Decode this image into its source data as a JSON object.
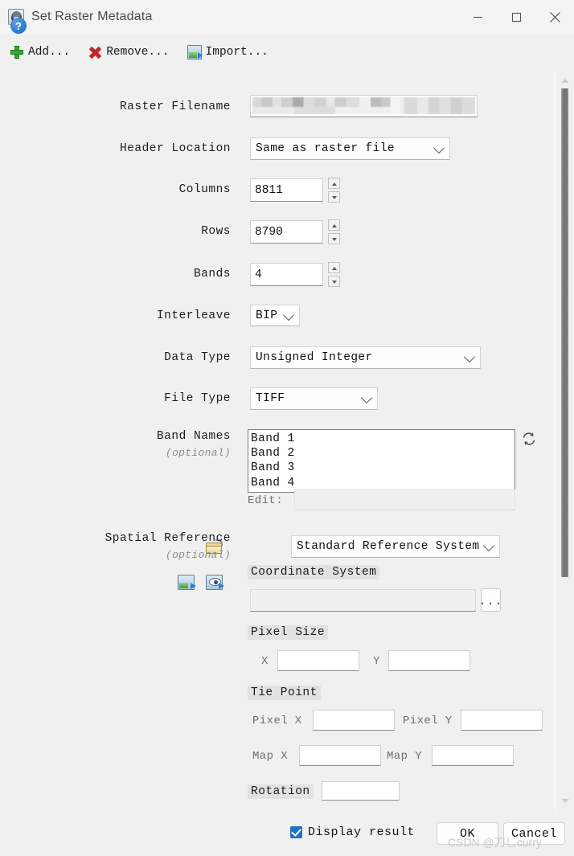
{
  "window": {
    "title": "Set Raster Metadata",
    "icon": "envi-app-icon",
    "controls": {
      "minimize": "minimize-icon",
      "maximize": "maximize-icon",
      "close": "close-icon"
    }
  },
  "toolbar": {
    "items": [
      {
        "label": "Add...",
        "icon": "plus-icon"
      },
      {
        "label": "Remove...",
        "icon": "red-x-icon"
      },
      {
        "label": "Import...",
        "icon": "import-image-icon"
      }
    ]
  },
  "form": {
    "raster_filename": {
      "label": "Raster Filename",
      "value": "",
      "redacted": true
    },
    "header_location": {
      "label": "Header Location",
      "value": "Same as raster file"
    },
    "columns": {
      "label": "Columns",
      "value": "8811"
    },
    "rows": {
      "label": "Rows",
      "value": "8790"
    },
    "bands": {
      "label": "Bands",
      "value": "4"
    },
    "interleave": {
      "label": "Interleave",
      "value": "BIP"
    },
    "data_type": {
      "label": "Data Type",
      "value": "Unsigned Integer"
    },
    "file_type": {
      "label": "File Type",
      "value": "TIFF"
    },
    "band_names": {
      "label": "Band Names",
      "sublabel": "(optional)",
      "items": [
        "Band 1",
        "Band 2",
        "Band 3",
        "Band 4"
      ],
      "edit_label": "Edit:",
      "edit_value": ""
    },
    "spatial_reference": {
      "label": "Spatial Reference",
      "sublabel": "(optional)",
      "mode": "Standard Reference System",
      "coordinate_system": {
        "header": "Coordinate System",
        "value": "",
        "browse_label": "..."
      },
      "pixel_size": {
        "header": "Pixel Size",
        "x_label": "X",
        "x_value": "",
        "y_label": "Y",
        "y_value": ""
      },
      "tie_point": {
        "header": "Tie Point",
        "pixel_x_label": "Pixel X",
        "pixel_x_value": "",
        "pixel_y_label": "Pixel Y",
        "pixel_y_value": "",
        "map_x_label": "Map X",
        "map_x_value": "",
        "map_y_label": "Map Y",
        "map_y_value": ""
      },
      "rotation": {
        "label": "Rotation",
        "value": ""
      }
    }
  },
  "footer": {
    "help_label": "?",
    "display_result": {
      "label": "Display result",
      "checked": true
    },
    "ok_label": "OK",
    "cancel_label": "Cancel"
  },
  "watermark": "CSDN @刀乚curry"
}
